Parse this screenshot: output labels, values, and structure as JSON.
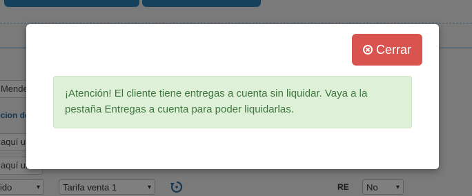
{
  "background": {
    "fields": [
      "Mende",
      "aquí un",
      "aquí un"
    ],
    "section_label": "ccion de",
    "selects": [
      {
        "value": "ido"
      },
      {
        "value": "Tarifa venta 1"
      },
      {
        "value": "No"
      }
    ],
    "re_label": "RE",
    "refresh_icon": "refresh-icon",
    "caret_glyph": "▾"
  },
  "modal": {
    "close_label": "Cerrar",
    "close_icon": "circle-x-icon",
    "alert_message": "¡Atención! El cliente tiene entregas a cuenta sin liquidar. Vaya a la pestaña Entregas a cuenta para poder liquidarlas."
  },
  "colors": {
    "danger": "#d9534f",
    "alert_bg": "#dff0d8",
    "alert_text": "#3c763d",
    "brand_blue": "#2d83b8"
  }
}
